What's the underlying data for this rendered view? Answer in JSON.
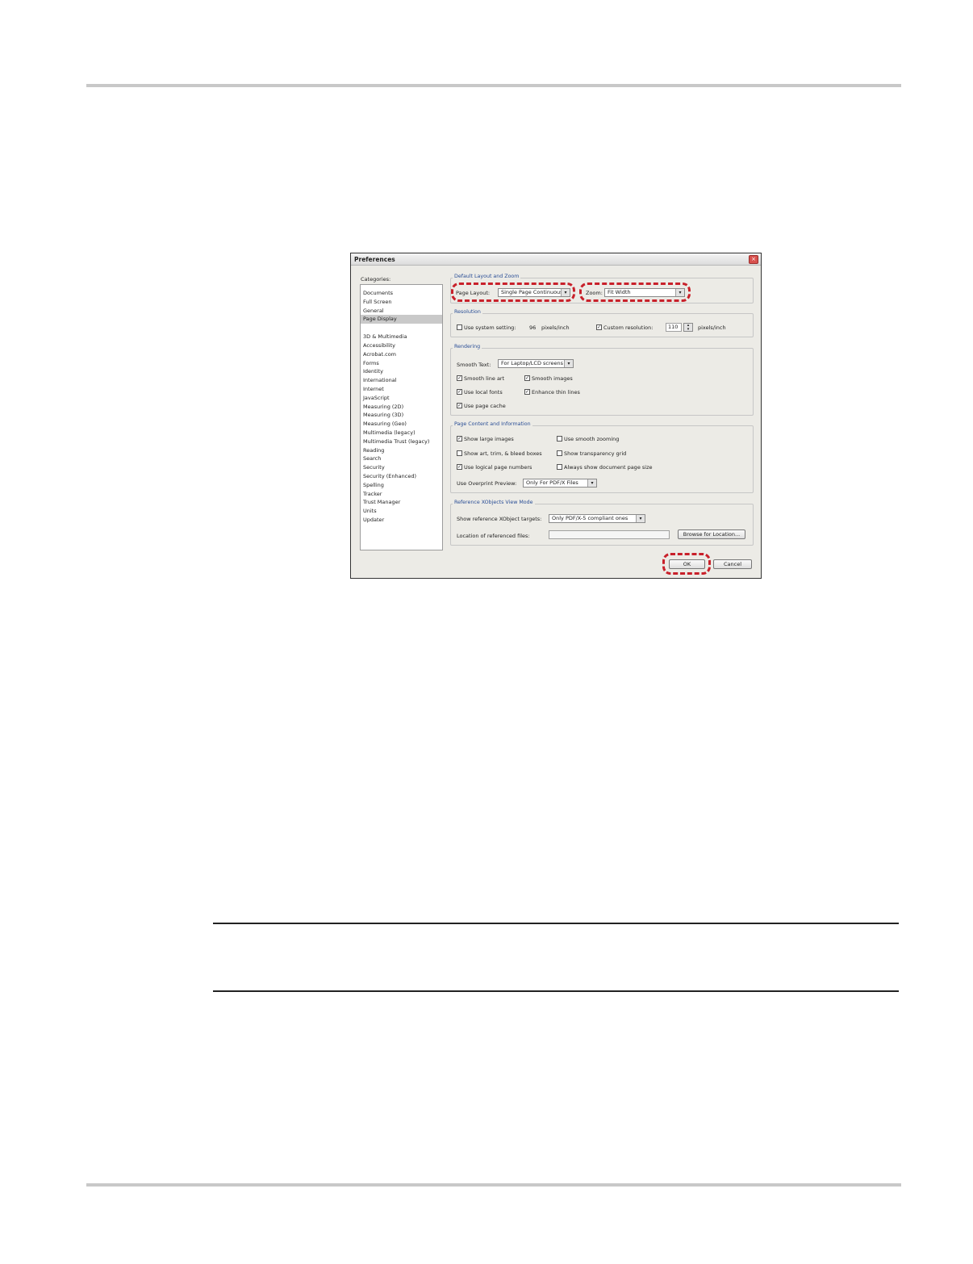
{
  "dialog": {
    "title": "Preferences",
    "close_glyph": "×",
    "categories_label": "Categories:",
    "categories_top": [
      "Documents",
      "Full Screen",
      "General",
      "Page Display"
    ],
    "categories_rest": [
      "3D & Multimedia",
      "Accessibility",
      "Acrobat.com",
      "Forms",
      "Identity",
      "International",
      "Internet",
      "JavaScript",
      "Measuring (2D)",
      "Measuring (3D)",
      "Measuring (Geo)",
      "Multimedia (legacy)",
      "Multimedia Trust (legacy)",
      "Reading",
      "Search",
      "Security",
      "Security (Enhanced)",
      "Spelling",
      "Tracker",
      "Trust Manager",
      "Units",
      "Updater"
    ],
    "selected_category": "Page Display",
    "layout_group": {
      "label": "Default Layout and Zoom",
      "page_layout_label": "Page Layout:",
      "page_layout_value": "Single Page Continuous",
      "zoom_label": "Zoom:",
      "zoom_value": "Fit Width"
    },
    "resolution_group": {
      "label": "Resolution",
      "use_system_label": "Use system setting:",
      "system_value": "96",
      "system_unit": "pixels/inch",
      "custom_label": "Custom resolution:",
      "custom_value": "110",
      "custom_unit": "pixels/inch",
      "use_system_checked": false,
      "custom_checked": true
    },
    "rendering_group": {
      "label": "Rendering",
      "smooth_text_label": "Smooth Text:",
      "smooth_text_value": "For Laptop/LCD screens",
      "smooth_line_art": "Smooth line art",
      "smooth_images": "Smooth images",
      "use_local_fonts": "Use local fonts",
      "enhance_thin_lines": "Enhance thin lines",
      "use_page_cache": "Use page cache"
    },
    "page_content_group": {
      "label": "Page Content and Information",
      "show_large_images": "Show large images",
      "use_smooth_zooming": "Use smooth zooming",
      "show_boxes": "Show art, trim, & bleed boxes",
      "show_transparency_grid": "Show transparency grid",
      "use_logical_page_numbers": "Use logical page numbers",
      "always_show_page_size": "Always show document page size",
      "overprint_label": "Use Overprint Preview:",
      "overprint_value": "Only For PDF/X Files"
    },
    "xobjects_group": {
      "label": "Reference XObjects View Mode",
      "targets_label": "Show reference XObject targets:",
      "targets_value": "Only PDF/X-5 compliant ones",
      "location_label": "Location of referenced files:",
      "location_value": "",
      "browse_label": "Browse for Location..."
    },
    "ok_label": "OK",
    "cancel_label": "Cancel",
    "check_glyph": "✓",
    "arrow_glyph": "▾",
    "spin_up_glyph": "▴",
    "spin_down_glyph": "▾"
  },
  "colors": {
    "highlight": "#c8202a",
    "group_label": "#2a4e96"
  }
}
